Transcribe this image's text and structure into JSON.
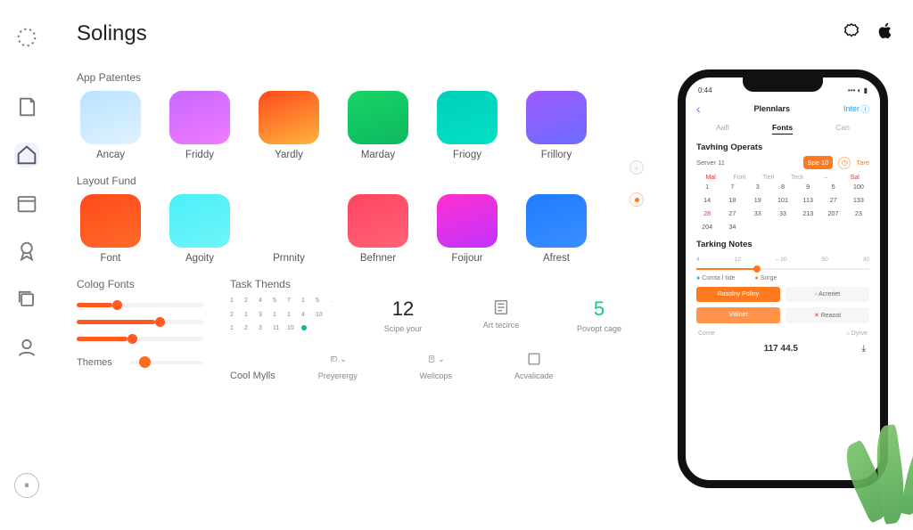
{
  "app": {
    "title": "Solings"
  },
  "sidebar": {
    "items": [
      "dashed",
      "home",
      "calendar",
      "badge",
      "copy",
      "user"
    ]
  },
  "sections": {
    "patentes": {
      "label": "App Patentes",
      "items": [
        {
          "label": "Ancay",
          "grad": "linear-gradient(160deg,#b9e3ff,#e0f2ff)"
        },
        {
          "label": "Friddy",
          "grad": "linear-gradient(160deg,#c768ff,#f07aff)"
        },
        {
          "label": "Yardly",
          "grad": "linear-gradient(160deg,#ff4a1f,#ffb43a)"
        },
        {
          "label": "Marday",
          "grad": "linear-gradient(160deg,#15d567,#0fb85f)"
        },
        {
          "label": "Friogy",
          "grad": "linear-gradient(160deg,#00d0b8,#03e0c6)"
        },
        {
          "label": "Frillory",
          "grad": "linear-gradient(160deg,#a05aff,#6a6dff)"
        }
      ]
    },
    "layout": {
      "label": "Layout Fund",
      "items": [
        {
          "label": "Font",
          "grad": "linear-gradient(160deg,#ff4a1a,#ff6a2a)"
        },
        {
          "label": "Agoity",
          "grad": "linear-gradient(160deg,#4af0f7,#6ff4fa)"
        },
        {
          "label": "Prnnity",
          "grad": ""
        },
        {
          "label": "Befnner",
          "grad": "linear-gradient(160deg,#ff4560,#ff6278)"
        },
        {
          "label": "Foijour",
          "grad": "linear-gradient(160deg,#ff2fd0,#c233ff)"
        },
        {
          "label": "Afrest",
          "grad": "linear-gradient(160deg,#1f7cff,#3a8eff)"
        }
      ]
    }
  },
  "colog": {
    "label": "Colog Fonts",
    "sliders": [
      {
        "fill": 28
      },
      {
        "fill": 62
      },
      {
        "fill": 40
      }
    ],
    "themes_label": "Themes"
  },
  "trends": {
    "label": "Task Thends",
    "cool_label": "Cool Mylls",
    "mini_cal": [
      "1",
      "2",
      "4",
      "5",
      "7",
      "1",
      "5",
      ".",
      "2",
      "1",
      "3",
      "1",
      "1",
      "4",
      "10",
      "",
      "1",
      "2",
      "3",
      "11",
      "10",
      "●",
      ""
    ],
    "stats": [
      {
        "value": "12",
        "caption": "Scipe your"
      },
      {
        "value": "icon",
        "caption": "Art tecirce"
      },
      {
        "value": "5",
        "caption": "Povopt cage",
        "teal": true
      }
    ],
    "foot": [
      {
        "caption": "Preyerergy"
      },
      {
        "caption": "Wellcops"
      },
      {
        "caption": "Acvalicade"
      }
    ]
  },
  "phone": {
    "time": "0:44",
    "nav": {
      "title": "Plennlars",
      "right": "Inter"
    },
    "tabs": [
      "Aafl",
      "Fonts",
      "Can"
    ],
    "active_tab": 1,
    "section1": "Tavhing Operats",
    "chips": {
      "server": "Server 11",
      "spe": "Spe 10",
      "tare": "Tare"
    },
    "cal_head": [
      "Mal",
      "Font",
      "Tierl",
      "Teck",
      "–",
      "Sal"
    ],
    "cal": [
      "1",
      "7",
      "3",
      "8",
      "9",
      "5",
      "100",
      "14",
      "18",
      "19",
      "101",
      "113",
      "27",
      "133",
      "28",
      "27",
      "33",
      "33",
      "213",
      "207",
      "23",
      "204",
      "34"
    ],
    "section2": "Tarking Notes",
    "scale": [
      "4",
      "12",
      "– 20",
      "50",
      "30"
    ],
    "legend": [
      "Comta l tide",
      "Sorge"
    ],
    "pills": [
      {
        "text": "Rasolny Poliny",
        "style": "solid"
      },
      {
        "text": "Acreriet",
        "style": "ghost",
        "prefix": "ar"
      },
      {
        "text": "Vitilnet",
        "style": "solid-lt"
      },
      {
        "text": "Reaost",
        "style": "ghost",
        "prefix": "x"
      }
    ],
    "bottom": [
      "Come",
      "Dyrve"
    ],
    "footer_value": "117 44.5"
  }
}
